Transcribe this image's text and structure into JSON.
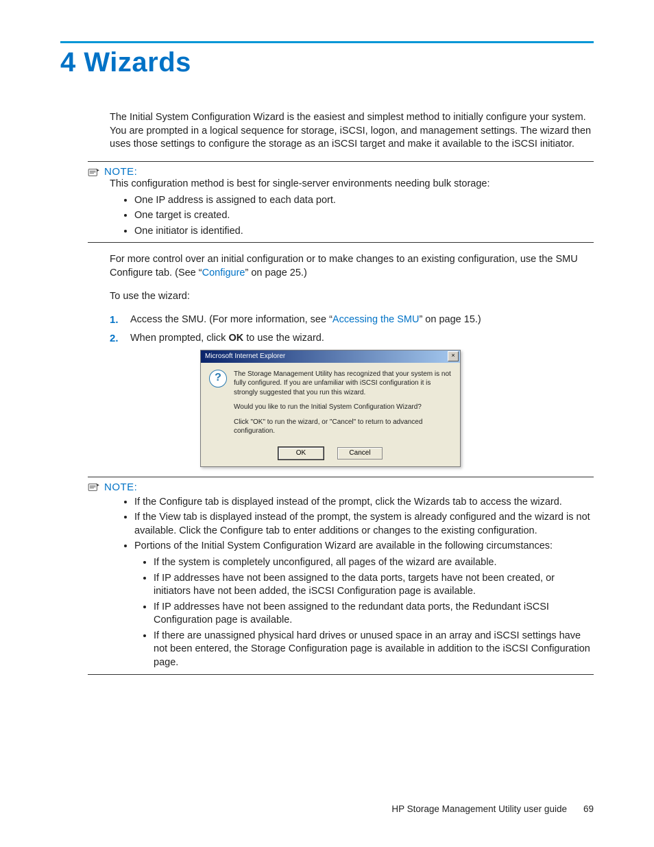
{
  "chapter": {
    "title": "4 Wizards"
  },
  "intro": "The Initial System Configuration Wizard is the easiest and simplest method to initially configure your system. You are prompted in a logical sequence for storage, iSCSI, logon, and management settings. The wizard then uses those settings to configure the storage as an iSCSI target and make it available to the iSCSI initiator.",
  "note1": {
    "label": "NOTE:",
    "lead": "This configuration method is best for single-server environments needing bulk storage:",
    "items": [
      "One IP address is assigned to each data port.",
      "One target is created.",
      "One initiator is identified."
    ]
  },
  "para2_a": "For more control over an initial configuration or to make changes to an existing configuration, use the SMU Configure tab. (See “",
  "para2_link": "Configure",
  "para2_b": "” on page 25.)",
  "para3": "To use the wizard:",
  "steps": {
    "s1_a": "Access the SMU. (For more information, see “",
    "s1_link": "Accessing the SMU",
    "s1_b": "” on page 15.)",
    "s2_a": "When prompted, click ",
    "s2_bold": "OK",
    "s2_b": " to use the wizard."
  },
  "dialog": {
    "title": "Microsoft Internet Explorer",
    "line1": "The Storage Management Utility has recognized that your system is not fully configured. If you are unfamiliar with iSCSI configuration it is strongly suggested that you run this wizard.",
    "line2": "Would you like to run the Initial System Configuration Wizard?",
    "line3": "Click \"OK\" to run the wizard, or \"Cancel\" to return to advanced configuration.",
    "ok": "OK",
    "cancel": "Cancel",
    "close": "×"
  },
  "note2": {
    "label": "NOTE:",
    "items": [
      "If the Configure tab is displayed instead of the prompt, click the Wizards tab to access the wizard.",
      "If the View tab is displayed instead of the prompt, the system is already configured and the wizard is not available. Click the Configure tab to enter additions or changes to the existing configuration.",
      "Portions of the Initial System Configuration Wizard are available in the following circumstances:"
    ],
    "sub": [
      "If the system is completely unconfigured, all pages of the wizard are available.",
      "If IP addresses have not been assigned to the data ports, targets have not been created, or initiators have not been added, the iSCSI Configuration page is available.",
      "If IP addresses have not been assigned to the redundant data ports, the Redundant iSCSI Configuration page is available.",
      "If there are unassigned physical hard drives or unused space in an array and iSCSI settings have not been entered, the Storage Configuration page is available in addition to the iSCSI Configuration page."
    ]
  },
  "footer": {
    "doc": "HP Storage Management Utility user guide",
    "page": "69"
  }
}
